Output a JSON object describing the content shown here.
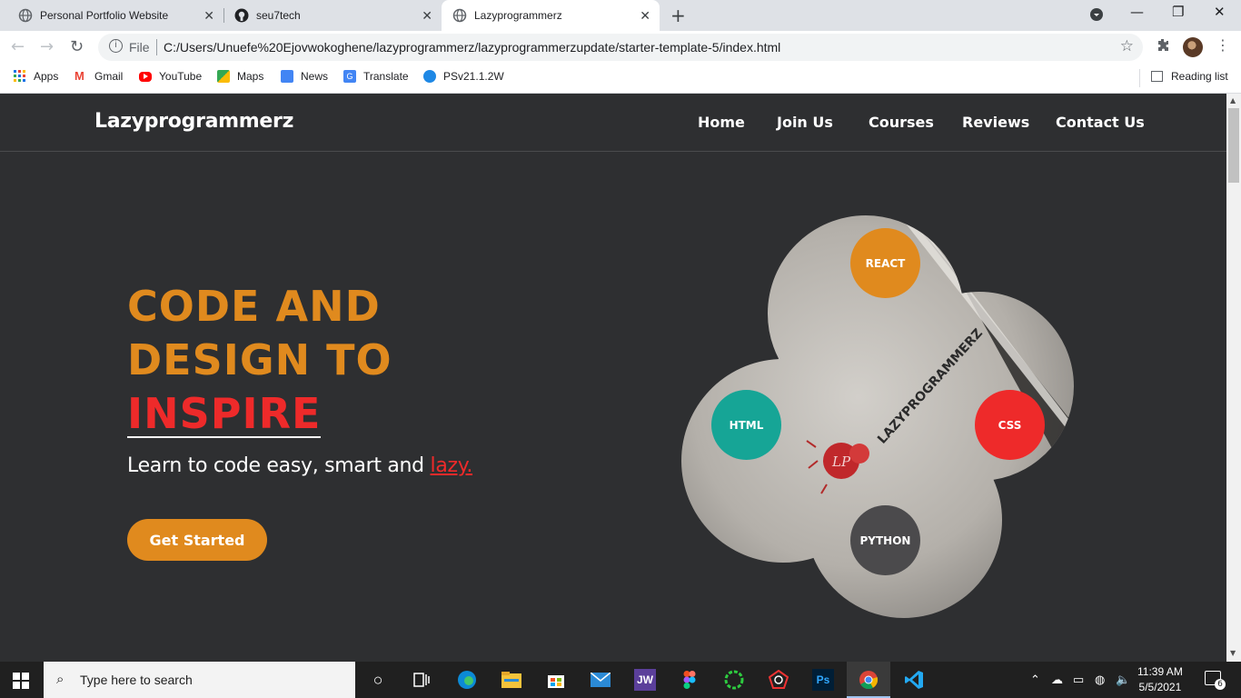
{
  "browser": {
    "tabs": [
      {
        "title": "Personal Portfolio Website",
        "active": false
      },
      {
        "title": "seu7tech",
        "active": false
      },
      {
        "title": "Lazyprogrammerz",
        "active": true
      }
    ],
    "address": {
      "scheme_label": "File",
      "url": "C:/Users/Unuefe%20Ejovwokoghene/lazyprogrammerz/lazyprogrammerzupdate/starter-template-5/index.html"
    },
    "bookmarks": [
      {
        "label": "Apps",
        "icon": "apps-grid-icon",
        "color": "#1a73e8"
      },
      {
        "label": "Gmail",
        "icon": "gmail-icon",
        "color": "#ea4335"
      },
      {
        "label": "YouTube",
        "icon": "youtube-icon",
        "color": "#ff0000"
      },
      {
        "label": "Maps",
        "icon": "maps-icon",
        "color": "#34a853"
      },
      {
        "label": "News",
        "icon": "news-icon",
        "color": "#4285f4"
      },
      {
        "label": "Translate",
        "icon": "translate-icon",
        "color": "#4285f4"
      },
      {
        "label": "PSv21.1.2W",
        "icon": "ps-icon",
        "color": "#1e88e5"
      }
    ],
    "reading_list": "Reading list"
  },
  "site": {
    "logo": "Lazyprogrammerz",
    "nav": [
      "Home",
      "Join Us",
      "Courses",
      "Reviews",
      "Contact Us"
    ],
    "hero": {
      "line1": "CODE AND",
      "line2": "DESIGN TO",
      "line3": "INSPIRE",
      "subtitle_prefix": "Learn to code easy, smart and ",
      "subtitle_accent": "lazy.",
      "cta": "Get Started"
    },
    "badges": [
      {
        "label": "REACT",
        "color": "#e08a1e"
      },
      {
        "label": "HTML",
        "color": "#16a596"
      },
      {
        "label": "CSS",
        "color": "#ee2a2a"
      },
      {
        "label": "PYTHON",
        "color": "#4b4a4c"
      }
    ],
    "card_text": "LAZYPROGRAMMERZ",
    "card_monogram": "LP",
    "colors": {
      "background": "#2e2f31",
      "accent_orange": "#e08a1e",
      "accent_red": "#ee2a2a"
    }
  },
  "taskbar": {
    "search_placeholder": "Type here to search",
    "apps": [
      "JW",
      "Ps"
    ],
    "time": "11:39 AM",
    "date": "5/5/2021",
    "notifications": "6"
  }
}
